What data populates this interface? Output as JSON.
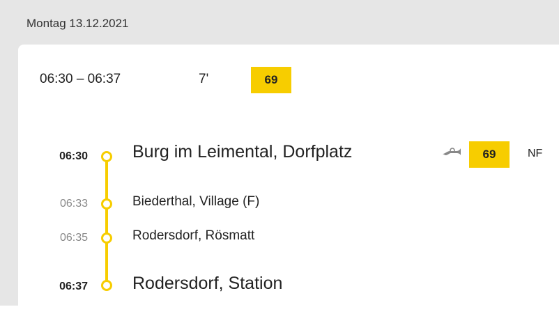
{
  "date_header": "Montag 13.12.2021",
  "summary": {
    "time_range": "06:30 – 06:37",
    "duration": "7'",
    "line": "69"
  },
  "colors": {
    "line_yellow": "#f7cd00",
    "header_bg": "#e6e6e6"
  },
  "stops": [
    {
      "time": "06:30",
      "name": "Burg im Leimental, Dorfplatz",
      "icon": "post-horn-icon",
      "line": "69",
      "extra": "NF"
    },
    {
      "time": "06:33",
      "name": "Biederthal, Village (F)"
    },
    {
      "time": "06:35",
      "name": "Rodersdorf, Rösmatt"
    },
    {
      "time": "06:37",
      "name": "Rodersdorf, Station"
    }
  ]
}
